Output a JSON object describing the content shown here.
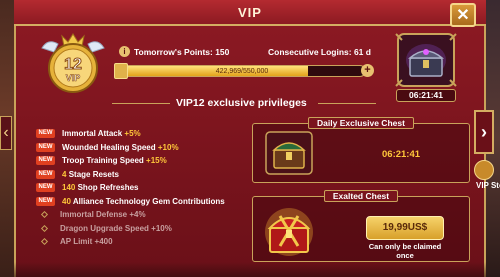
{
  "window": {
    "title": "VIP",
    "close_icon": "close-icon"
  },
  "vip": {
    "level_number": "12",
    "level_label": "VIP"
  },
  "status": {
    "tomorrow_points_label": "Tomorrow's Points: 150",
    "consecutive_logins_label": "Consecutive Logins: 61 d"
  },
  "progress": {
    "text": "422,969/550,000",
    "current": 422969,
    "max": 550000
  },
  "top_chest": {
    "timer": "06:21:41"
  },
  "section": {
    "title": "VIP12 exclusive privileges"
  },
  "privileges": [
    {
      "is_new": true,
      "tag": "NEW",
      "name": "Immortal Attack",
      "value": "+5%",
      "value_first": false,
      "unlocked": true
    },
    {
      "is_new": true,
      "tag": "NEW",
      "name": "Wounded Healing Speed",
      "value": "+10%",
      "value_first": false,
      "unlocked": true
    },
    {
      "is_new": true,
      "tag": "NEW",
      "name": "Troop Training Speed",
      "value": "+15%",
      "value_first": false,
      "unlocked": true
    },
    {
      "is_new": true,
      "tag": "NEW",
      "name": "Stage Resets",
      "value": "4",
      "value_first": true,
      "unlocked": true
    },
    {
      "is_new": true,
      "tag": "NEW",
      "name": "Shop Refreshes",
      "value": "140",
      "value_first": true,
      "unlocked": true
    },
    {
      "is_new": true,
      "tag": "NEW",
      "name": "Alliance Technology Gem Contributions",
      "value": "40",
      "value_first": true,
      "unlocked": true
    },
    {
      "is_new": false,
      "tag": "",
      "name": "Immortal Defense",
      "value": "+4%",
      "value_first": false,
      "unlocked": false
    },
    {
      "is_new": false,
      "tag": "",
      "name": "Dragon Upgrade Speed",
      "value": "+10%",
      "value_first": false,
      "unlocked": false
    },
    {
      "is_new": false,
      "tag": "",
      "name": "AP Limit",
      "value": "+400",
      "value_first": false,
      "unlocked": false
    }
  ],
  "daily_chest": {
    "title": "Daily Exclusive Chest",
    "timer": "06:21:41"
  },
  "exalted_chest": {
    "title": "Exalted Chest",
    "price": "19,99US$",
    "note": "Can only be claimed once"
  },
  "nav": {
    "vip_store_label": "VIP Stor"
  },
  "colors": {
    "panel": "#8e1a24",
    "gold": "#c9a35a",
    "value_yellow": "#ffc83a",
    "new_tag": "#e04020"
  }
}
